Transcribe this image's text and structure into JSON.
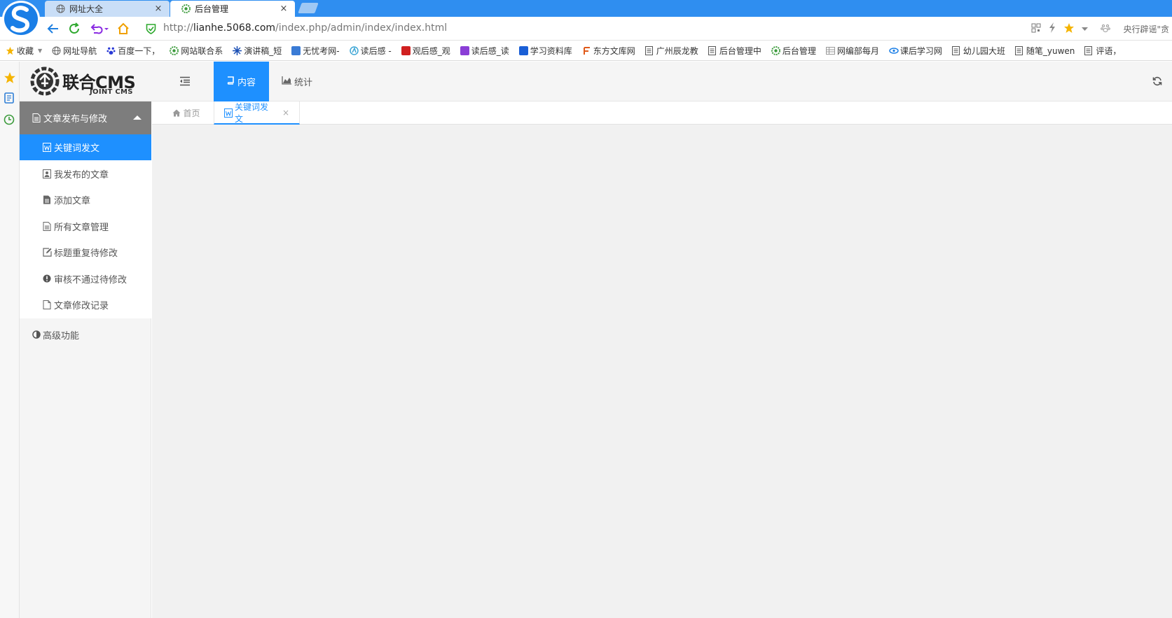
{
  "browser": {
    "tabs": [
      {
        "title": "网址大全",
        "active": false
      },
      {
        "title": "后台管理",
        "active": true
      }
    ],
    "close_glyph": "×",
    "url_prefix": "http://",
    "url_host": "lianhe.5068.com",
    "url_path": "/index.php/admin/index/index.html",
    "search_hint": "央行辟谣\"贪",
    "bookmarks": [
      {
        "label": "收藏",
        "icon": "star-icon",
        "color": "#f5b400"
      },
      {
        "label": "网址导航",
        "icon": "globe-icon",
        "color": "#777777"
      },
      {
        "label": "百度一下，",
        "icon": "baidu-paw-icon",
        "color": "#2a3ad6"
      },
      {
        "label": "网站联合系",
        "icon": "joint-logo-icon",
        "color": "#3c9b3c"
      },
      {
        "label": "演讲稿_短",
        "icon": "speech-icon",
        "color": "#1a4fb4"
      },
      {
        "label": "无忧考网-",
        "icon": "exam-icon",
        "color": "#3a7bd5"
      },
      {
        "label": "读后感 -",
        "icon": "reading-icon",
        "color": "#3fa7d6"
      },
      {
        "label": "观后感_观",
        "icon": "li-icon",
        "color": "#d02020"
      },
      {
        "label": "读后感_读",
        "icon": "du-icon",
        "color": "#8a3ed6"
      },
      {
        "label": "学习资料库",
        "icon": "study-icon",
        "color": "#1a5fd6"
      },
      {
        "label": "东方文库网",
        "icon": "dongfang-icon",
        "color": "#e05a1a"
      },
      {
        "label": "广州辰龙教",
        "icon": "page-icon",
        "color": "#555555"
      },
      {
        "label": "后台管理中",
        "icon": "page-icon",
        "color": "#555555"
      },
      {
        "label": "后台管理",
        "icon": "joint-logo-icon",
        "color": "#3c9b3c"
      },
      {
        "label": "网编部每月",
        "icon": "sheet-icon",
        "color": "#9a9a9a"
      },
      {
        "label": "课后学习网",
        "icon": "eye-icon",
        "color": "#1a7ee6"
      },
      {
        "label": "幼儿园大班",
        "icon": "page-icon",
        "color": "#555555"
      },
      {
        "label": "随笔_yuwen",
        "icon": "page-icon",
        "color": "#555555"
      },
      {
        "label": "评语，",
        "icon": "page-icon",
        "color": "#555555"
      }
    ]
  },
  "cms": {
    "brand": "联合CMS",
    "brand_sub": "JOINT CMS",
    "top_tabs": [
      {
        "label": "内容",
        "icon": "book-icon",
        "active": true
      },
      {
        "label": "统计",
        "icon": "area-chart-icon",
        "active": false
      }
    ],
    "sidebar": {
      "group_label": "文章发布与修改",
      "items": [
        {
          "label": "关键词发文",
          "icon": "word-file-icon",
          "selected": true
        },
        {
          "label": "我发布的文章",
          "icon": "user-file-icon",
          "selected": false
        },
        {
          "label": "添加文章",
          "icon": "file-text-icon",
          "selected": false
        },
        {
          "label": "所有文章管理",
          "icon": "file-lines-icon",
          "selected": false
        },
        {
          "label": "标题重复待修改",
          "icon": "edit-icon",
          "selected": false
        },
        {
          "label": "审核不通过待修改",
          "icon": "exclamation-circle-icon",
          "selected": false
        },
        {
          "label": "文章修改记录",
          "icon": "file-outline-icon",
          "selected": false
        }
      ],
      "group2_label": "高级功能"
    },
    "page_tabs": [
      {
        "label": "首页",
        "icon": "home-icon"
      },
      {
        "label": "关键词发文",
        "icon": "word-file-icon",
        "closable": true
      }
    ]
  },
  "colors": {
    "browser_blue": "#2f8ef0",
    "accent": "#1e90ff",
    "sidebar_group": "#7d7d7d",
    "content_bg": "#f1f1f1"
  }
}
